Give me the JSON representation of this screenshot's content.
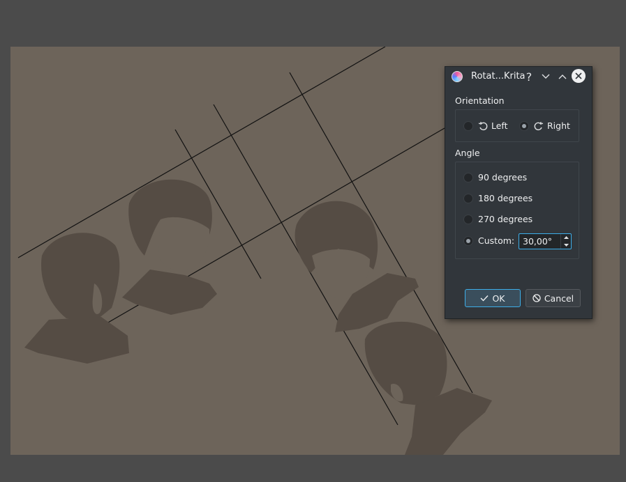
{
  "dialog": {
    "title": "Rotat...Krita",
    "help_label": "?",
    "orientation": {
      "label": "Orientation",
      "left_label": "Left",
      "right_label": "Right",
      "selected": "Right"
    },
    "angle": {
      "label": "Angle",
      "option_90": "90 degrees",
      "option_180": "180 degrees",
      "option_270": "270 degrees",
      "custom_label": "Custom:",
      "custom_value": "30,00°",
      "selected": "Custom"
    },
    "ok_label": "OK",
    "cancel_label": "Cancel"
  },
  "colors": {
    "app_background": "#4b4b4b",
    "canvas_background": "#6d645a",
    "sketch_fill": "#554c44",
    "dialog_background": "#31363b",
    "accent": "#3daee9"
  },
  "icons": {
    "app": "krita-icon",
    "minimize": "chevron-down-icon",
    "maximize": "chevron-up-icon",
    "close": "close-icon",
    "rotate_left": "rotate-left-icon",
    "rotate_right": "rotate-right-icon",
    "ok": "checkmark-icon",
    "cancel": "cancel-icon"
  }
}
